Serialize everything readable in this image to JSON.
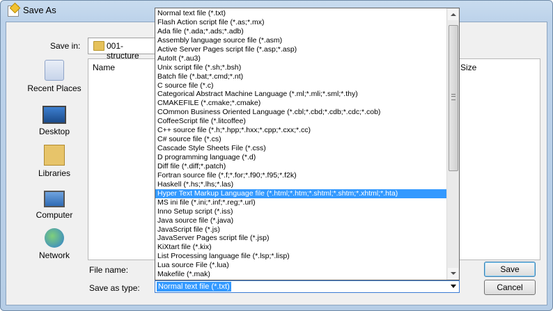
{
  "window": {
    "title": "Save As"
  },
  "save_in": {
    "label": "Save in:",
    "folder": "001-structure"
  },
  "places": [
    {
      "label": "Recent Places",
      "icon": "recent-places-icon"
    },
    {
      "label": "Desktop",
      "icon": "desktop-icon"
    },
    {
      "label": "Libraries",
      "icon": "libraries-icon"
    },
    {
      "label": "Computer",
      "icon": "computer-icon"
    },
    {
      "label": "Network",
      "icon": "network-icon"
    }
  ],
  "file_list": {
    "columns": [
      "Name",
      "Size"
    ]
  },
  "file_name": {
    "label": "File name:"
  },
  "save_as_type": {
    "label": "Save as type:",
    "value": "Normal text file (*.txt)",
    "options": [
      "Normal text file (*.txt)",
      "Flash Action script file (*.as;*.mx)",
      "Ada file (*.ada;*.ads;*.adb)",
      "Assembly language source file (*.asm)",
      "Active Server Pages script file (*.asp;*.asp)",
      "AutoIt (*.au3)",
      "Unix script file (*.sh;*.bsh)",
      "Batch file (*.bat;*.cmd;*.nt)",
      "C source file (*.c)",
      "Categorical Abstract Machine Language (*.ml;*.mli;*.sml;*.thy)",
      "CMAKEFILE (*.cmake;*.cmake)",
      "COmmon Business Oriented Language (*.cbl;*.cbd;*.cdb;*.cdc;*.cob)",
      "CoffeeScript file (*.litcoffee)",
      "C++ source file (*.h;*.hpp;*.hxx;*.cpp;*.cxx;*.cc)",
      "C# source file (*.cs)",
      "Cascade Style Sheets File (*.css)",
      "D programming language (*.d)",
      "Diff file (*.diff;*.patch)",
      "Fortran source file (*.f;*.for;*.f90;*.f95;*.f2k)",
      "Haskell (*.hs;*.lhs;*.las)",
      "Hyper Text Markup Language file (*.html;*.htm;*.shtml;*.shtm;*.xhtml;*.hta)",
      "MS ini file (*.ini;*.inf;*.reg;*.url)",
      "Inno Setup script (*.iss)",
      "Java source file (*.java)",
      "JavaScript file (*.js)",
      "JavaServer Pages script file (*.jsp)",
      "KiXtart file (*.kix)",
      "List Processing language file (*.lsp;*.lisp)",
      "Lua source File (*.lua)",
      "Makefile (*.mak)"
    ],
    "highlighted_index": 20
  },
  "buttons": {
    "save": "Save",
    "cancel": "Cancel"
  },
  "colors": {
    "highlight": "#3399ff",
    "frame": "#bcd2ea"
  }
}
